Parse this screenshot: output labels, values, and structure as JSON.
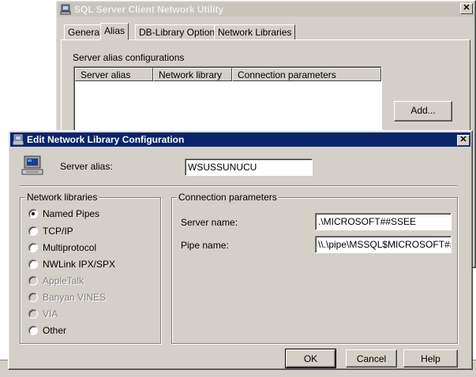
{
  "back_window": {
    "title": "SQL Server Client Network Utility",
    "tabs": [
      "General",
      "Alias",
      "DB-Library Options",
      "Network Libraries"
    ],
    "selected_tab": "Alias",
    "section_label": "Server alias configurations",
    "columns": [
      "Server alias",
      "Network library",
      "Connection parameters"
    ],
    "add_button": "Add..."
  },
  "dialog": {
    "title": "Edit Network Library Configuration",
    "server_alias_label": "Server alias:",
    "server_alias_value": "WSUSSUNUCU",
    "network_libraries": {
      "title": "Network libraries",
      "options": [
        {
          "label": "Named Pipes",
          "checked": true,
          "enabled": true
        },
        {
          "label": "TCP/IP",
          "checked": false,
          "enabled": true
        },
        {
          "label": "Multiprotocol",
          "checked": false,
          "enabled": true
        },
        {
          "label": "NWLink IPX/SPX",
          "checked": false,
          "enabled": true
        },
        {
          "label": "AppleTalk",
          "checked": false,
          "enabled": false
        },
        {
          "label": "Banyan VINES",
          "checked": false,
          "enabled": false
        },
        {
          "label": "VIA",
          "checked": false,
          "enabled": false
        },
        {
          "label": "Other",
          "checked": false,
          "enabled": true
        }
      ]
    },
    "connection_parameters": {
      "title": "Connection parameters",
      "server_name_label": "Server name:",
      "server_name_value": ".\\MICROSOFT##SSEE",
      "pipe_name_label": "Pipe name:",
      "pipe_name_value": "\\\\.\\pipe\\MSSQL$MICROSOFT##"
    },
    "buttons": {
      "ok": "OK",
      "cancel": "Cancel",
      "help": "Help"
    }
  },
  "colors": {
    "face": "#d4d0c8",
    "active_title": "#0a246a",
    "inactive_title": "#c8c4bc"
  },
  "icons": [
    "computer-icon",
    "close-icon"
  ]
}
